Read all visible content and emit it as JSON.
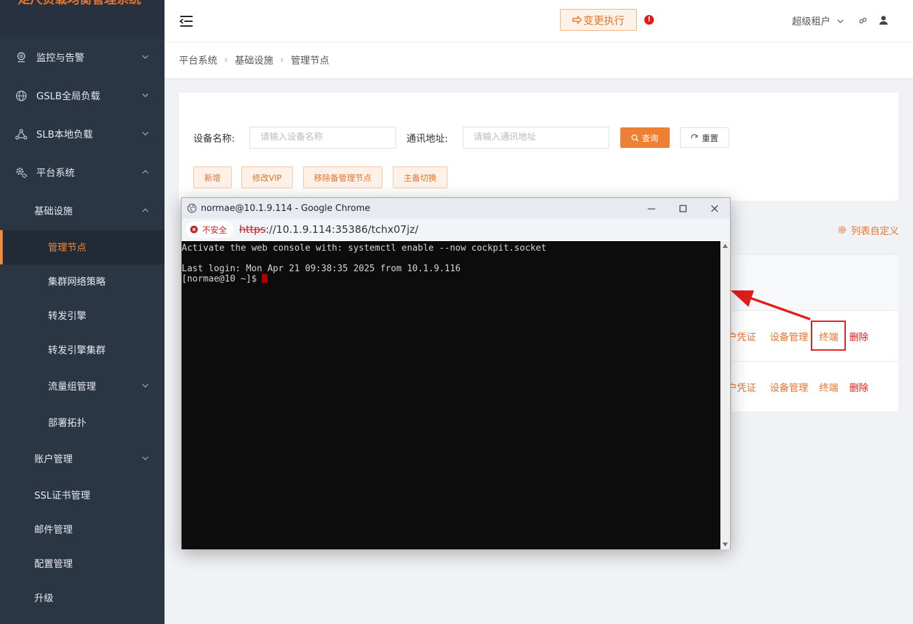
{
  "app": {
    "title": "矩尺负载均衡管理系统"
  },
  "sidebar": {
    "items": [
      {
        "label": "监控与告警",
        "icon": "location-pin-icon"
      },
      {
        "label": "GSLB全局负载",
        "icon": "globe-icon"
      },
      {
        "label": "SLB本地负载",
        "icon": "network-nodes-icon"
      },
      {
        "label": "平台系统",
        "icon": "gear-icon"
      },
      {
        "label": "基础设施"
      },
      {
        "label": "管理节点"
      },
      {
        "label": "集群网络策略"
      },
      {
        "label": "转发引擎"
      },
      {
        "label": "转发引擎集群"
      },
      {
        "label": "流量组管理"
      },
      {
        "label": "部署拓扑"
      },
      {
        "label": "账户管理"
      },
      {
        "label": "SSL证书管理"
      },
      {
        "label": "邮件管理"
      },
      {
        "label": "配置管理"
      },
      {
        "label": "升级"
      }
    ]
  },
  "header": {
    "change_button": "变更执行",
    "alert_mark": "!",
    "tenant": "超级租户"
  },
  "breadcrumb": [
    "平台系统",
    "基础设施",
    "管理节点"
  ],
  "filters": {
    "device_name_label": "设备名称:",
    "device_name_placeholder": "请输入设备名称",
    "address_label": "通讯地址:",
    "address_placeholder": "请输入通讯地址",
    "query_button": "查询",
    "reset_button": "重置"
  },
  "actions": {
    "add": "新增",
    "modify_vip": "修改VIP",
    "remove_standby": "移除备管理节点",
    "switch": "主备切换"
  },
  "table": {
    "column_settings": "列表自定义",
    "rows": [
      {
        "credential": "户凭证",
        "device_mgmt": "设备管理",
        "terminal": "终端",
        "delete": "删除"
      },
      {
        "credential": "户凭证",
        "device_mgmt": "设备管理",
        "terminal": "终端",
        "delete": "删除"
      }
    ]
  },
  "chrome_window": {
    "title": "normae@10.1.9.114 - Google Chrome",
    "insecure_label": "不安全",
    "url_scheme": "https",
    "url_rest": "://10.1.9.114:35386/tchx07jz/",
    "terminal_lines": [
      "Activate the web console with: systemctl enable --now cockpit.socket",
      "",
      "Last login: Mon Apr 21 09:38:35 2025 from 10.1.9.116",
      "[normae@10 ~]$ "
    ]
  },
  "colors": {
    "accent": "#e8742d",
    "sidebar": "#2b3645",
    "danger": "#e31b1b"
  }
}
